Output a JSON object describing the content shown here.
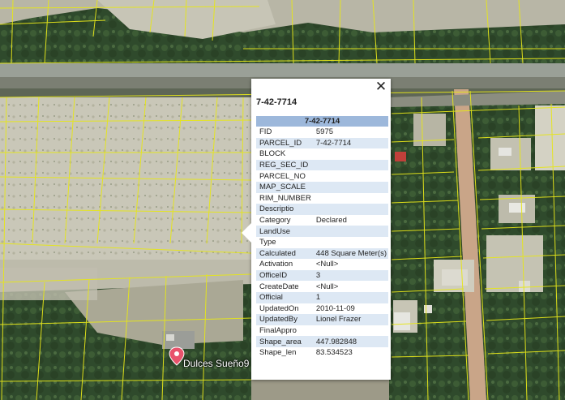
{
  "popup": {
    "title": "7-42-7714",
    "table_header": "7-42-7714",
    "close_symbol": "✕",
    "rows": [
      {
        "key": "FID",
        "value": "5975"
      },
      {
        "key": "PARCEL_ID",
        "value": "7-42-7714"
      },
      {
        "key": "BLOCK",
        "value": ""
      },
      {
        "key": "REG_SEC_ID",
        "value": ""
      },
      {
        "key": "PARCEL_NO",
        "value": ""
      },
      {
        "key": "MAP_SCALE",
        "value": ""
      },
      {
        "key": "RIM_NUMBER",
        "value": ""
      },
      {
        "key": "Descriptio",
        "value": ""
      },
      {
        "key": "Category",
        "value": "Declared"
      },
      {
        "key": "LandUse",
        "value": ""
      },
      {
        "key": "Type",
        "value": ""
      },
      {
        "key": "Calculated",
        "value": "448 Square Meter(s)"
      },
      {
        "key": "Activation",
        "value": "<Null>"
      },
      {
        "key": "OfficeID",
        "value": "3"
      },
      {
        "key": "CreateDate",
        "value": "<Null>"
      },
      {
        "key": "Official",
        "value": "1"
      },
      {
        "key": "UpdatedOn",
        "value": "2010-11-09"
      },
      {
        "key": "UpdatedBy",
        "value": "Lionel Frazer"
      },
      {
        "key": "FinalAppro",
        "value": ""
      },
      {
        "key": "Shape_area",
        "value": "447.982848"
      },
      {
        "key": "Shape_len",
        "value": "83.534523"
      }
    ]
  },
  "marker": {
    "label": "Dulces Sueño9",
    "color": "#e8536c"
  },
  "colors": {
    "parcel_lines": "#e6e61a",
    "table_header_bg": "#9db8db",
    "row_alt_bg": "#dde8f4"
  }
}
